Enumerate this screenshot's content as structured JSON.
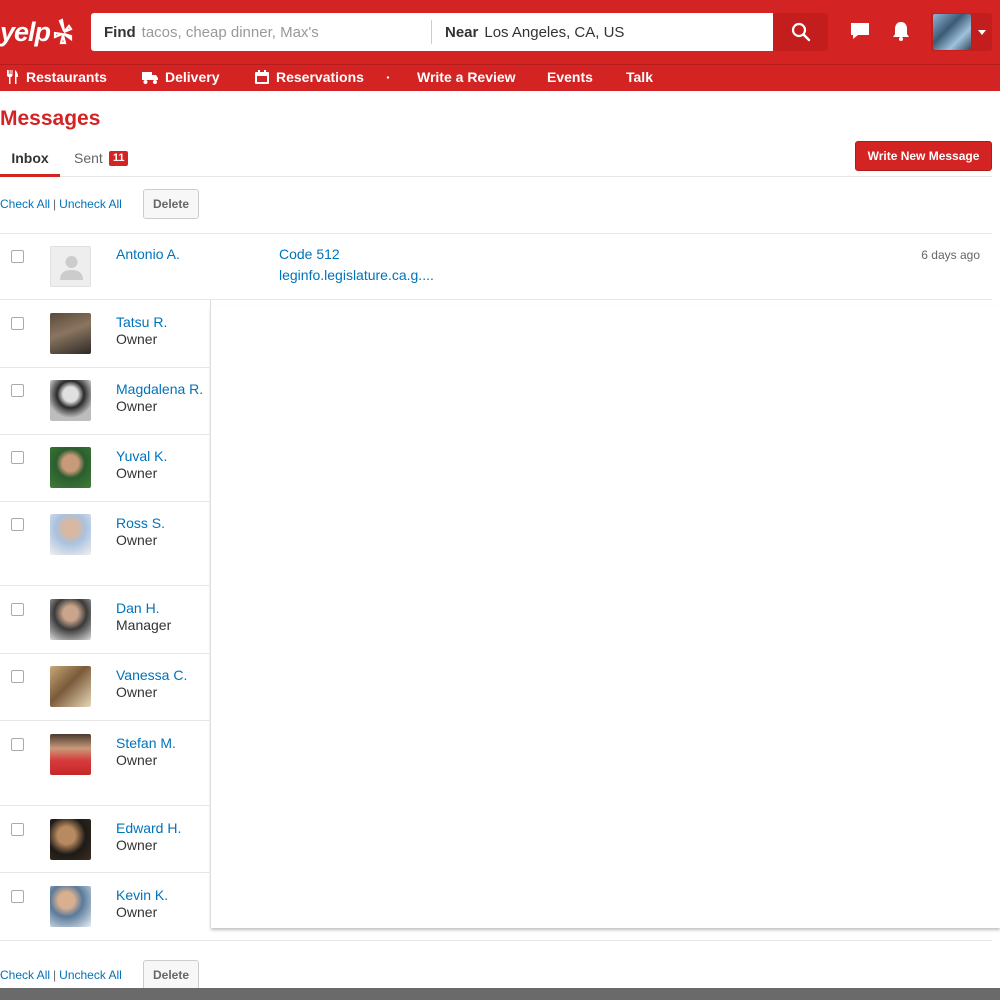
{
  "header": {
    "logo_text": "yelp",
    "find_label": "Find",
    "find_placeholder": "tacos, cheap dinner, Max's",
    "near_label": "Near",
    "near_value": "Los Angeles, CA, US",
    "icons": [
      "search-icon",
      "chat-icon",
      "bell-icon",
      "user-avatar",
      "chevron-down-icon"
    ]
  },
  "nav": {
    "items": [
      {
        "label": "Restaurants",
        "icon": "utensils-icon"
      },
      {
        "label": "Delivery",
        "icon": "truck-icon"
      },
      {
        "label": "Reservations",
        "icon": "calendar-icon"
      },
      {
        "label": "Write a Review"
      },
      {
        "label": "Events"
      },
      {
        "label": "Talk"
      }
    ],
    "separator": "·"
  },
  "page": {
    "title": "Messages",
    "tabs": [
      {
        "label": "Inbox",
        "active": true
      },
      {
        "label": "Sent",
        "count": "11"
      }
    ],
    "write_button": "Write New Message",
    "bulk": {
      "check_all": "Check All",
      "separator": "|",
      "uncheck_all": "Uncheck All",
      "delete": "Delete"
    }
  },
  "message": {
    "sender": "Antonio A.",
    "subject": "Code 512",
    "snippet": "leginfo.legislature.ca.g....",
    "time": "6 days ago"
  },
  "contacts": [
    {
      "name": "Tatsu R.",
      "role": "Owner"
    },
    {
      "name": "Magdalena R.",
      "role": "Owner"
    },
    {
      "name": "Yuval K.",
      "role": "Owner"
    },
    {
      "name": "Ross S.",
      "role": "Owner"
    },
    {
      "name": "Dan H.",
      "role": "Manager"
    },
    {
      "name": "Vanessa C.",
      "role": "Owner"
    },
    {
      "name": "Stefan M.",
      "role": "Owner"
    },
    {
      "name": "Edward H.",
      "role": "Owner"
    },
    {
      "name": "Kevin K.",
      "role": "Owner"
    }
  ],
  "colors": {
    "brand": "#d32323",
    "link": "#0073bb"
  }
}
